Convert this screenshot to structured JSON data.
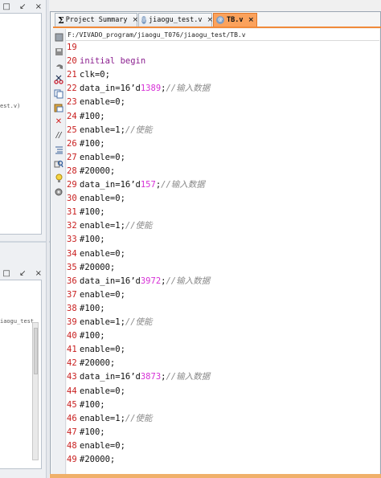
{
  "tabs": [
    {
      "label": "Project Summary",
      "close": "×",
      "icon": "sigma-icon"
    },
    {
      "label": "jiaogu_test.v",
      "close": "×",
      "icon": "verilog-file-icon"
    },
    {
      "label": "TB.v",
      "close": "×",
      "icon": "verilog-file-icon",
      "active": true
    }
  ],
  "path": "F:/VIVADO_program/jiaogu_T076/jiaogu_test/TB.v",
  "left_panel": {
    "top_tools": "□ ↙ ×",
    "top_fragment": "est.v)",
    "bottom_tools": "□ ↙ ×",
    "bottom_fragment": "iaogu_test"
  },
  "toolbar_icons": [
    "sheet-icon",
    "save-icon",
    "undo-icon",
    "cut-icon",
    "copy-icon",
    "paste-icon",
    "delete-icon",
    "comment-icon",
    "indent-icon",
    "find-icon",
    "bulb-icon",
    "gear-icon"
  ],
  "code_lines": [
    {
      "n": "19",
      "parts": [
        {
          "t": ""
        }
      ]
    },
    {
      "n": "20",
      "parts": [
        {
          "t": "initial begin",
          "c": "kw"
        }
      ]
    },
    {
      "n": "21",
      "parts": [
        {
          "t": "clk=0;"
        }
      ]
    },
    {
      "n": "22",
      "parts": [
        {
          "t": "data_in=16’d"
        },
        {
          "t": "1389",
          "c": "num"
        },
        {
          "t": ";"
        },
        {
          "t": "//输入数据",
          "c": "cm"
        }
      ]
    },
    {
      "n": "23",
      "parts": [
        {
          "t": "enable=0;"
        }
      ]
    },
    {
      "n": "24",
      "parts": [
        {
          "t": "#100;"
        }
      ]
    },
    {
      "n": "25",
      "parts": [
        {
          "t": "enable=1;"
        },
        {
          "t": "//使能",
          "c": "cm"
        }
      ]
    },
    {
      "n": "26",
      "parts": [
        {
          "t": "#100;"
        }
      ]
    },
    {
      "n": "27",
      "parts": [
        {
          "t": "enable=0;"
        }
      ]
    },
    {
      "n": "28",
      "parts": [
        {
          "t": "#20000;"
        }
      ]
    },
    {
      "n": "29",
      "parts": [
        {
          "t": "data_in=16’d"
        },
        {
          "t": "157",
          "c": "num"
        },
        {
          "t": ";"
        },
        {
          "t": "//输入数据",
          "c": "cm"
        }
      ]
    },
    {
      "n": "30",
      "parts": [
        {
          "t": "enable=0;"
        }
      ]
    },
    {
      "n": "31",
      "parts": [
        {
          "t": "#100;"
        }
      ]
    },
    {
      "n": "32",
      "parts": [
        {
          "t": "enable=1;"
        },
        {
          "t": "//使能",
          "c": "cm"
        }
      ]
    },
    {
      "n": "33",
      "parts": [
        {
          "t": "#100;"
        }
      ]
    },
    {
      "n": "34",
      "parts": [
        {
          "t": "enable=0;"
        }
      ]
    },
    {
      "n": "35",
      "parts": [
        {
          "t": "#20000;"
        }
      ]
    },
    {
      "n": "36",
      "parts": [
        {
          "t": "data_in=16’d"
        },
        {
          "t": "3972",
          "c": "num"
        },
        {
          "t": ";"
        },
        {
          "t": "//输入数据",
          "c": "cm"
        }
      ]
    },
    {
      "n": "37",
      "parts": [
        {
          "t": "enable=0;"
        }
      ]
    },
    {
      "n": "38",
      "parts": [
        {
          "t": "#100;"
        }
      ]
    },
    {
      "n": "39",
      "parts": [
        {
          "t": "enable=1;"
        },
        {
          "t": "//使能",
          "c": "cm"
        }
      ]
    },
    {
      "n": "40",
      "parts": [
        {
          "t": "#100;"
        }
      ]
    },
    {
      "n": "41",
      "parts": [
        {
          "t": "enable=0;"
        }
      ]
    },
    {
      "n": "42",
      "parts": [
        {
          "t": "#20000;"
        }
      ]
    },
    {
      "n": "43",
      "parts": [
        {
          "t": "data_in=16’d"
        },
        {
          "t": "3873",
          "c": "num"
        },
        {
          "t": ";"
        },
        {
          "t": "//输入数据",
          "c": "cm"
        }
      ]
    },
    {
      "n": "44",
      "parts": [
        {
          "t": "enable=0;"
        }
      ]
    },
    {
      "n": "45",
      "parts": [
        {
          "t": "#100;"
        }
      ]
    },
    {
      "n": "46",
      "parts": [
        {
          "t": "enable=1;"
        },
        {
          "t": "//使能",
          "c": "cm"
        }
      ]
    },
    {
      "n": "47",
      "parts": [
        {
          "t": "#100;"
        }
      ]
    },
    {
      "n": "48",
      "parts": [
        {
          "t": "enable=0;"
        }
      ]
    },
    {
      "n": "49",
      "parts": [
        {
          "t": "#20000;"
        }
      ]
    }
  ],
  "colors": {
    "active_tab": "#fba25c",
    "line_number": "#c81e1e",
    "keyword": "#8b1f8f",
    "number": "#d62fd6",
    "comment": "#888888"
  }
}
